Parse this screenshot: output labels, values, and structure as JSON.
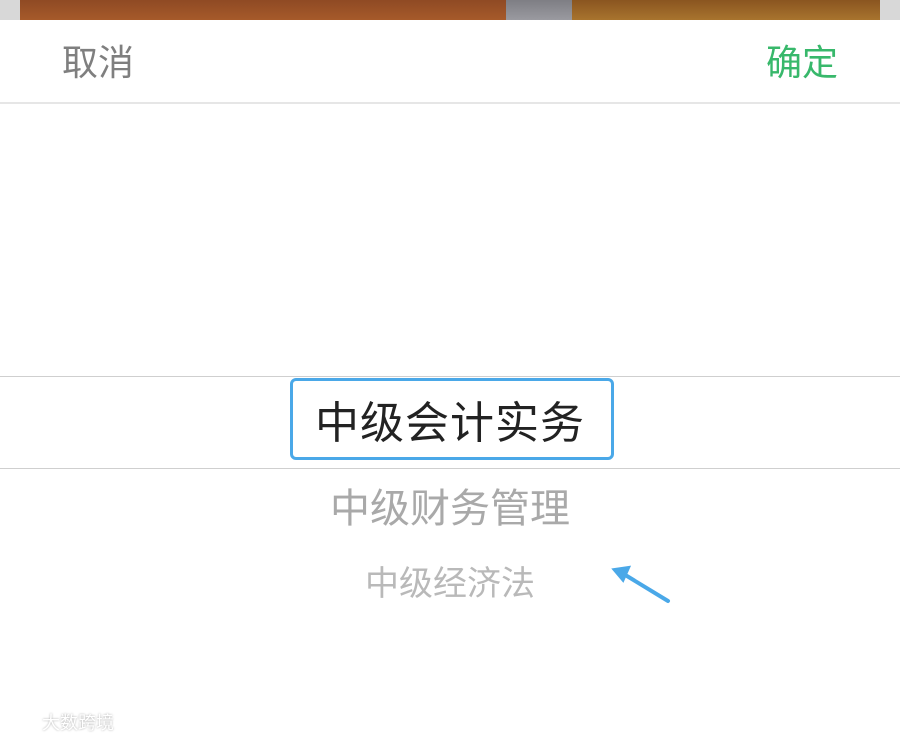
{
  "toolbar": {
    "cancel_label": "取消",
    "confirm_label": "确定"
  },
  "picker": {
    "options": [
      {
        "label": "中级会计实务",
        "state": "selected"
      },
      {
        "label": "中级财务管理",
        "state": "normal"
      },
      {
        "label": "中级经济法",
        "state": "normal"
      }
    ]
  },
  "watermark": {
    "text": "大数跨境"
  },
  "colors": {
    "confirm": "#38b86b",
    "cancel": "#7f7f7f",
    "annotation": "#4aa8e8"
  },
  "icons": {
    "annotation_arrow": "arrow-icon",
    "watermark_logo": "watermark-logo-icon"
  }
}
